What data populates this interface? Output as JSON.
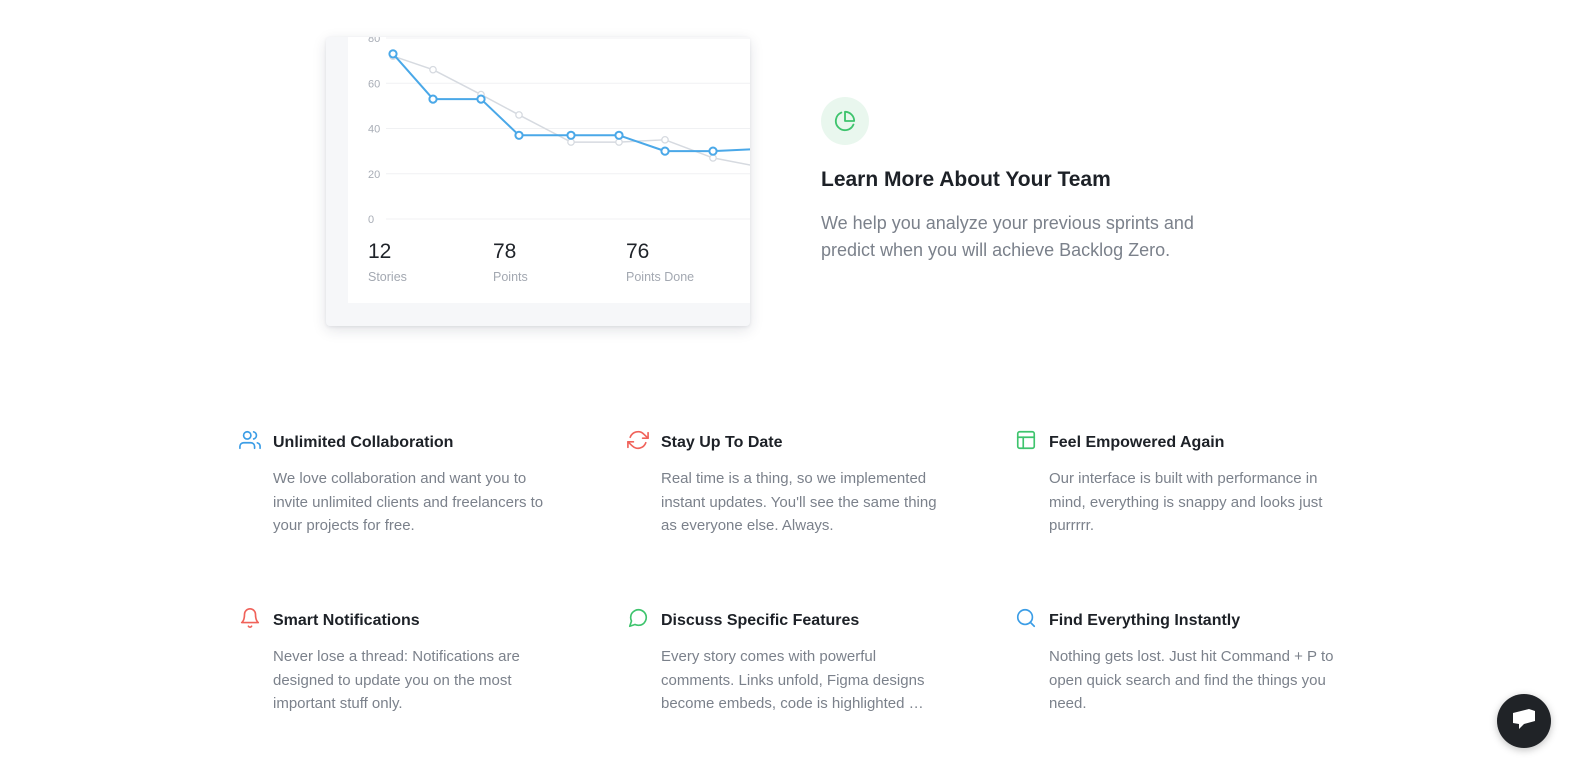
{
  "chart_data": {
    "type": "line",
    "yticks": [
      "0",
      "20",
      "40",
      "60",
      "80"
    ],
    "ylim": [
      0,
      80
    ],
    "grid": true,
    "series": [
      {
        "values": [
          72,
          66,
          55,
          46,
          34,
          34,
          35,
          27,
          23
        ],
        "color": "#d6dae0"
      },
      {
        "values": [
          73,
          53,
          53,
          37,
          37,
          37,
          30,
          30,
          31
        ],
        "color": "#4aa8e8"
      }
    ]
  },
  "stats": [
    {
      "value": "12",
      "label": "Stories"
    },
    {
      "value": "78",
      "label": "Points"
    },
    {
      "value": "76",
      "label": "Points Done"
    }
  ],
  "info": {
    "icon": "pie-chart-icon",
    "title": "Learn More About Your Team",
    "description": "We help you analyze your previous sprints and predict when you will achieve Backlog Zero."
  },
  "features": [
    {
      "icon": "users-icon",
      "color": "#3b9de6",
      "title": "Unlimited Collaboration",
      "description": "We love collaboration and want you to invite unlimited clients and freelancers to your projects for free."
    },
    {
      "icon": "refresh-icon",
      "color": "#f0625a",
      "title": "Stay Up To Date",
      "description": "Real time is a thing, so we implemented instant updates. You'll see the same thing as everyone else. Always."
    },
    {
      "icon": "layout-icon",
      "color": "#3ec46d",
      "title": "Feel Empowered Again",
      "description": "Our interface is built with performance in mind, everything is snappy and looks just purrrrr."
    },
    {
      "icon": "bell-icon",
      "color": "#f0625a",
      "title": "Smart Notifications",
      "description": "Never lose a thread: Notifications are designed to update you on the most important stuff only."
    },
    {
      "icon": "message-circle-icon",
      "color": "#3ec46d",
      "title": "Discuss Specific Features",
      "description": "Every story comes with powerful comments. Links unfold, Figma designs become embeds, code is highlighted …"
    },
    {
      "icon": "search-icon",
      "color": "#3b9de6",
      "title": "Find Everything Instantly",
      "description": "Nothing gets lost. Just hit Command + P to open quick search and find the things you need."
    }
  ],
  "chat": {
    "icon": "chat-icon"
  }
}
